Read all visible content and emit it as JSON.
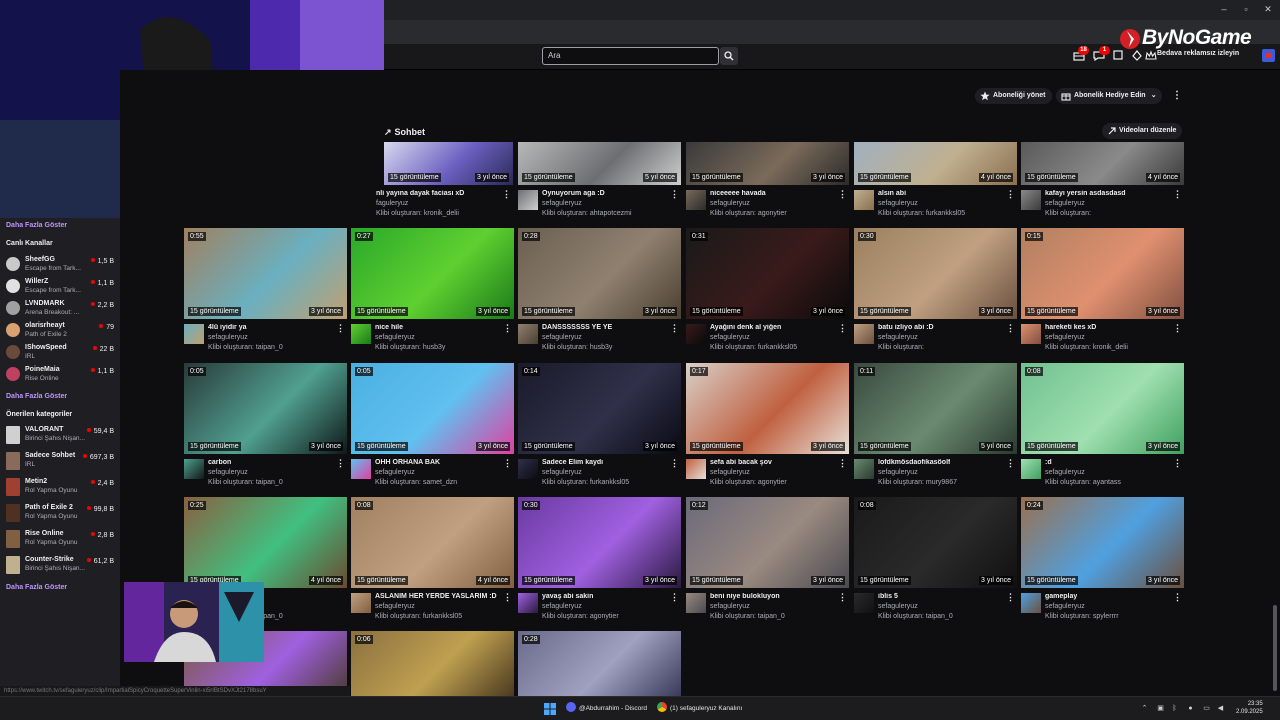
{
  "search": {
    "placeholder": "Ara"
  },
  "topnav": {
    "badge_1": "18",
    "badge_2": "1",
    "adfree_label": "Bedava reklamsız izleyin"
  },
  "watermark": {
    "text": "ByNoGame"
  },
  "actions": {
    "manage_sub": "Aboneliği yönet",
    "gift_sub": "Abonelik Hediye Edin",
    "section_title": "Sohbet",
    "edit_videos": "Videoları düzenle"
  },
  "sidebar": {
    "show_more_top": "Daha Fazla Göster",
    "live_header": "Canlı Kanallar",
    "channels": [
      {
        "name": "SheefGG",
        "sub": "Escape from Tark...",
        "count": "1,5 B",
        "color": "#c9c9c9"
      },
      {
        "name": "WillerZ",
        "sub": "Escape from Tark...",
        "count": "1,1 B",
        "color": "#e0e0e0"
      },
      {
        "name": "LVNDMARK",
        "sub": "Arena Breakout: ...",
        "count": "2,2 B",
        "color": "#a0a0a0"
      },
      {
        "name": "olarisrheayt",
        "sub": "Path of Exile 2",
        "count": "79",
        "color": "#d9a070"
      },
      {
        "name": "IShowSpeed",
        "sub": "IRL",
        "count": "22 B",
        "color": "#6a4a3a"
      },
      {
        "name": "PoineMaia",
        "sub": "Rise Online",
        "count": "1,1 B",
        "color": "#c04060"
      }
    ],
    "show_more_mid": "Daha Fazla Göster",
    "cat_header": "Önerilen kategoriler",
    "categories": [
      {
        "name": "VALORANT",
        "sub": "Birinci Şahıs Nişan...",
        "count": "59,4 B",
        "color": "#d0d0d0"
      },
      {
        "name": "Sadece Sohbet",
        "sub": "IRL",
        "count": "697,3 B",
        "color": "#8a6a5a"
      },
      {
        "name": "Metin2",
        "sub": "Rol Yapma Oyunu",
        "count": "2,4 B",
        "color": "#a04030"
      },
      {
        "name": "Path of Exile 2",
        "sub": "Rol Yapma Oyunu",
        "count": "99,8 B",
        "color": "#503020"
      },
      {
        "name": "Rise Online",
        "sub": "Rol Yapma Oyunu",
        "count": "2,8 B",
        "color": "#806040"
      },
      {
        "name": "Counter-Strike",
        "sub": "Birinci Şahıs Nişan...",
        "count": "61,2 B",
        "color": "#c0b090"
      }
    ],
    "show_more_bottom": "Daha Fazla Göster"
  },
  "rows": [
    [
      {
        "title": "nli yayına dayak faciası xD",
        "channel": "faguleryuz",
        "clip": "Klibi oluşturan: kronik_delii",
        "views": "15 görüntüleme",
        "ago": "3 yıl önce",
        "duration": "",
        "colors": [
          "#d8d8ef",
          "#6a5fc0",
          "#2b2a55"
        ]
      },
      {
        "title": "Oynuyorum aga :D",
        "channel": "sefaguleryuz",
        "clip": "Klibi oluşturan: ahtapotcezmi",
        "views": "15 görüntüleme",
        "ago": "5 yıl önce",
        "duration": "",
        "colors": [
          "#b8b8b8",
          "#6c6f72",
          "#cfcfcf"
        ]
      },
      {
        "title": "niceeeee havada",
        "channel": "sefaguleryuz",
        "clip": "Klibi oluşturan: agonytier",
        "views": "15 görüntüleme",
        "ago": "3 yıl önce",
        "duration": "",
        "colors": [
          "#3a3a3a",
          "#7a6a5a",
          "#2b2b2b"
        ]
      },
      {
        "title": "alsın abi",
        "channel": "sefaguleryuz",
        "clip": "Klibi oluşturan: furkankksl05",
        "views": "15 görüntüleme",
        "ago": "4 yıl önce",
        "duration": "",
        "colors": [
          "#a0b0c0",
          "#c0b090",
          "#8a6f4f"
        ]
      },
      {
        "title": "kafayı yersin asdasdasd",
        "channel": "sefaguleryuz",
        "clip": "Klibi oluşturan:",
        "views": "15 görüntüleme",
        "ago": "4 yıl önce",
        "duration": "",
        "colors": [
          "#5a5a5a",
          "#8a8a8a",
          "#3a3a3a"
        ]
      }
    ],
    [
      {
        "title": "4lü iyidir ya",
        "channel": "sefaguleryuz",
        "clip": "Klibi oluşturan: taipan_0",
        "views": "15 görüntüleme",
        "ago": "3 yıl önce",
        "duration": "0:55",
        "colors": [
          "#a08060",
          "#6ab0c0",
          "#c0a070"
        ]
      },
      {
        "title": "nice hile",
        "channel": "sefaguleryuz",
        "clip": "Klibi oluşturan: husb3y",
        "views": "15 görüntüleme",
        "ago": "3 yıl önce",
        "duration": "0:27",
        "colors": [
          "#2aa82a",
          "#5fd030",
          "#1a7a1a"
        ]
      },
      {
        "title": "DANSSSSSSS YE YE",
        "channel": "sefaguleryuz",
        "clip": "Klibi oluşturan: husb3y",
        "views": "15 görüntüleme",
        "ago": "3 yıl önce",
        "duration": "0:28",
        "colors": [
          "#6a6050",
          "#908070",
          "#4a4030"
        ]
      },
      {
        "title": "Ayağını denk al yiğen",
        "channel": "sefaguleryuz",
        "clip": "Klibi oluşturan: furkankksl05",
        "views": "15 görüntüleme",
        "ago": "3 yıl önce",
        "duration": "0:31",
        "colors": [
          "#1a1a1a",
          "#3a1a1a",
          "#0a0a0a"
        ]
      },
      {
        "title": "batu izliyo abi :D",
        "channel": "sefaguleryuz",
        "clip": "Klibi oluşturan:",
        "views": "15 görüntüleme",
        "ago": "3 yıl önce",
        "duration": "0:30",
        "colors": [
          "#9a8060",
          "#c0a080",
          "#6a5040"
        ]
      },
      {
        "title": "hareketi kes xD",
        "channel": "sefaguleryuz",
        "clip": "Klibi oluşturan: kronik_delii",
        "views": "15 görüntüleme",
        "ago": "3 yıl önce",
        "duration": "0:15",
        "colors": [
          "#b08060",
          "#e09070",
          "#805040"
        ]
      }
    ],
    [
      {
        "title": "carbon",
        "channel": "sefaguleryuz",
        "clip": "Klibi oluşturan: taipan_0",
        "views": "15 görüntüleme",
        "ago": "3 yıl önce",
        "duration": "0:05",
        "colors": [
          "#2a3a3a",
          "#50a090",
          "#101818"
        ]
      },
      {
        "title": "OHH ORHANA BAK",
        "channel": "sefaguleryuz",
        "clip": "Klibi oluşturan: samet_dzn",
        "views": "15 görüntüleme",
        "ago": "3 yıl önce",
        "duration": "0:05",
        "colors": [
          "#4ab0e0",
          "#60c0f0",
          "#e040a0"
        ]
      },
      {
        "title": "Sadece Elim kaydı",
        "channel": "sefaguleryuz",
        "clip": "Klibi oluşturan: furkankksl05",
        "views": "15 görüntüleme",
        "ago": "3 yıl önce",
        "duration": "0:14",
        "colors": [
          "#1a1a2a",
          "#30304a",
          "#0a0a14"
        ]
      },
      {
        "title": "sefa abi bacak şov",
        "channel": "sefaguleryuz",
        "clip": "Klibi oluşturan: agonytier",
        "views": "15 görüntüleme",
        "ago": "3 yıl önce",
        "duration": "0:17",
        "colors": [
          "#d8d0c8",
          "#c06040",
          "#e8e0d8"
        ]
      },
      {
        "title": "lofdkmösdaofikasöolf",
        "channel": "sefaguleryuz",
        "clip": "Klibi oluşturan: mury9867",
        "views": "15 görüntüleme",
        "ago": "5 yıl önce",
        "duration": "0:11",
        "colors": [
          "#3a4a40",
          "#6a8a70",
          "#2a3a30"
        ]
      },
      {
        "title": ":d",
        "channel": "sefaguleryuz",
        "clip": "Klibi oluşturan: ayantass",
        "views": "15 görüntüleme",
        "ago": "3 yıl önce",
        "duration": "0:08",
        "colors": [
          "#70c090",
          "#a0e0b0",
          "#40a060"
        ]
      }
    ],
    [
      {
        "title": "",
        "channel": "",
        "clip": "Klibi oluşturan: taipan_0",
        "views": "15 görüntüleme",
        "ago": "4 yıl önce",
        "duration": "0:25",
        "colors": [
          "#8a6040",
          "#40c080",
          "#6a4a30"
        ]
      },
      {
        "title": "ASLANIM HER YERDE YASLARIM :D",
        "channel": "sefaguleryuz",
        "clip": "Klibi oluşturan: furkankksl05",
        "views": "15 görüntüleme",
        "ago": "4 yıl önce",
        "duration": "0:08",
        "colors": [
          "#a08060",
          "#c0a080",
          "#806040"
        ]
      },
      {
        "title": "yavaş abi sakin",
        "channel": "sefaguleryuz",
        "clip": "Klibi oluşturan: agonytier",
        "views": "15 görüntüleme",
        "ago": "3 yıl önce",
        "duration": "0:30",
        "colors": [
          "#6a3aa0",
          "#a060e0",
          "#2a1a40"
        ]
      },
      {
        "title": "beni niye bulokluyon",
        "channel": "sefaguleryuz",
        "clip": "Klibi oluşturan: taipan_0",
        "views": "15 görüntüleme",
        "ago": "3 yıl önce",
        "duration": "0:12",
        "colors": [
          "#6a6a7a",
          "#9a8a80",
          "#4a4a50"
        ]
      },
      {
        "title": "iblis 5",
        "channel": "sefaguleryuz",
        "clip": "Klibi oluşturan: taipan_0",
        "views": "15 görüntüleme",
        "ago": "3 yıl önce",
        "duration": "0:08",
        "colors": [
          "#1a1a1a",
          "#2a2a2a",
          "#101010"
        ]
      },
      {
        "title": "gameplay",
        "channel": "sefaguleryuz",
        "clip": "Klibi oluşturan: spylerrrr",
        "views": "15 görüntüleme",
        "ago": "3 yıl önce",
        "duration": "0:24",
        "colors": [
          "#9a7050",
          "#50a0e0",
          "#6a5040"
        ]
      }
    ],
    [
      {
        "title": "",
        "channel": "",
        "clip": "",
        "views": "",
        "ago": "",
        "duration": "",
        "colors": [
          "#7a5a40",
          "#a060e0",
          "#4a3a30"
        ]
      },
      {
        "title": "",
        "channel": "",
        "clip": "",
        "views": "",
        "ago": "",
        "duration": "0:06",
        "colors": [
          "#8a7040",
          "#c0a050",
          "#4a3a20"
        ]
      },
      {
        "title": "",
        "channel": "",
        "clip": "",
        "views": "",
        "ago": "",
        "duration": "0:28",
        "colors": [
          "#6a6a8a",
          "#a0a0c0",
          "#3a3a5a"
        ]
      }
    ]
  ],
  "statusbar": {
    "url": "https://www.twitch.tv/sefaguleryuz/clip/ImpartialSpicyCroquetteSuperVinlin-xi5rIBtSDvXJt2178bsuY"
  },
  "taskbar": {
    "discord_label": "@Abdurrahim - Discord",
    "chrome_label": "(1) sefaguleryuz Kanalını",
    "time": "23:35",
    "date": "2.09.2025"
  }
}
